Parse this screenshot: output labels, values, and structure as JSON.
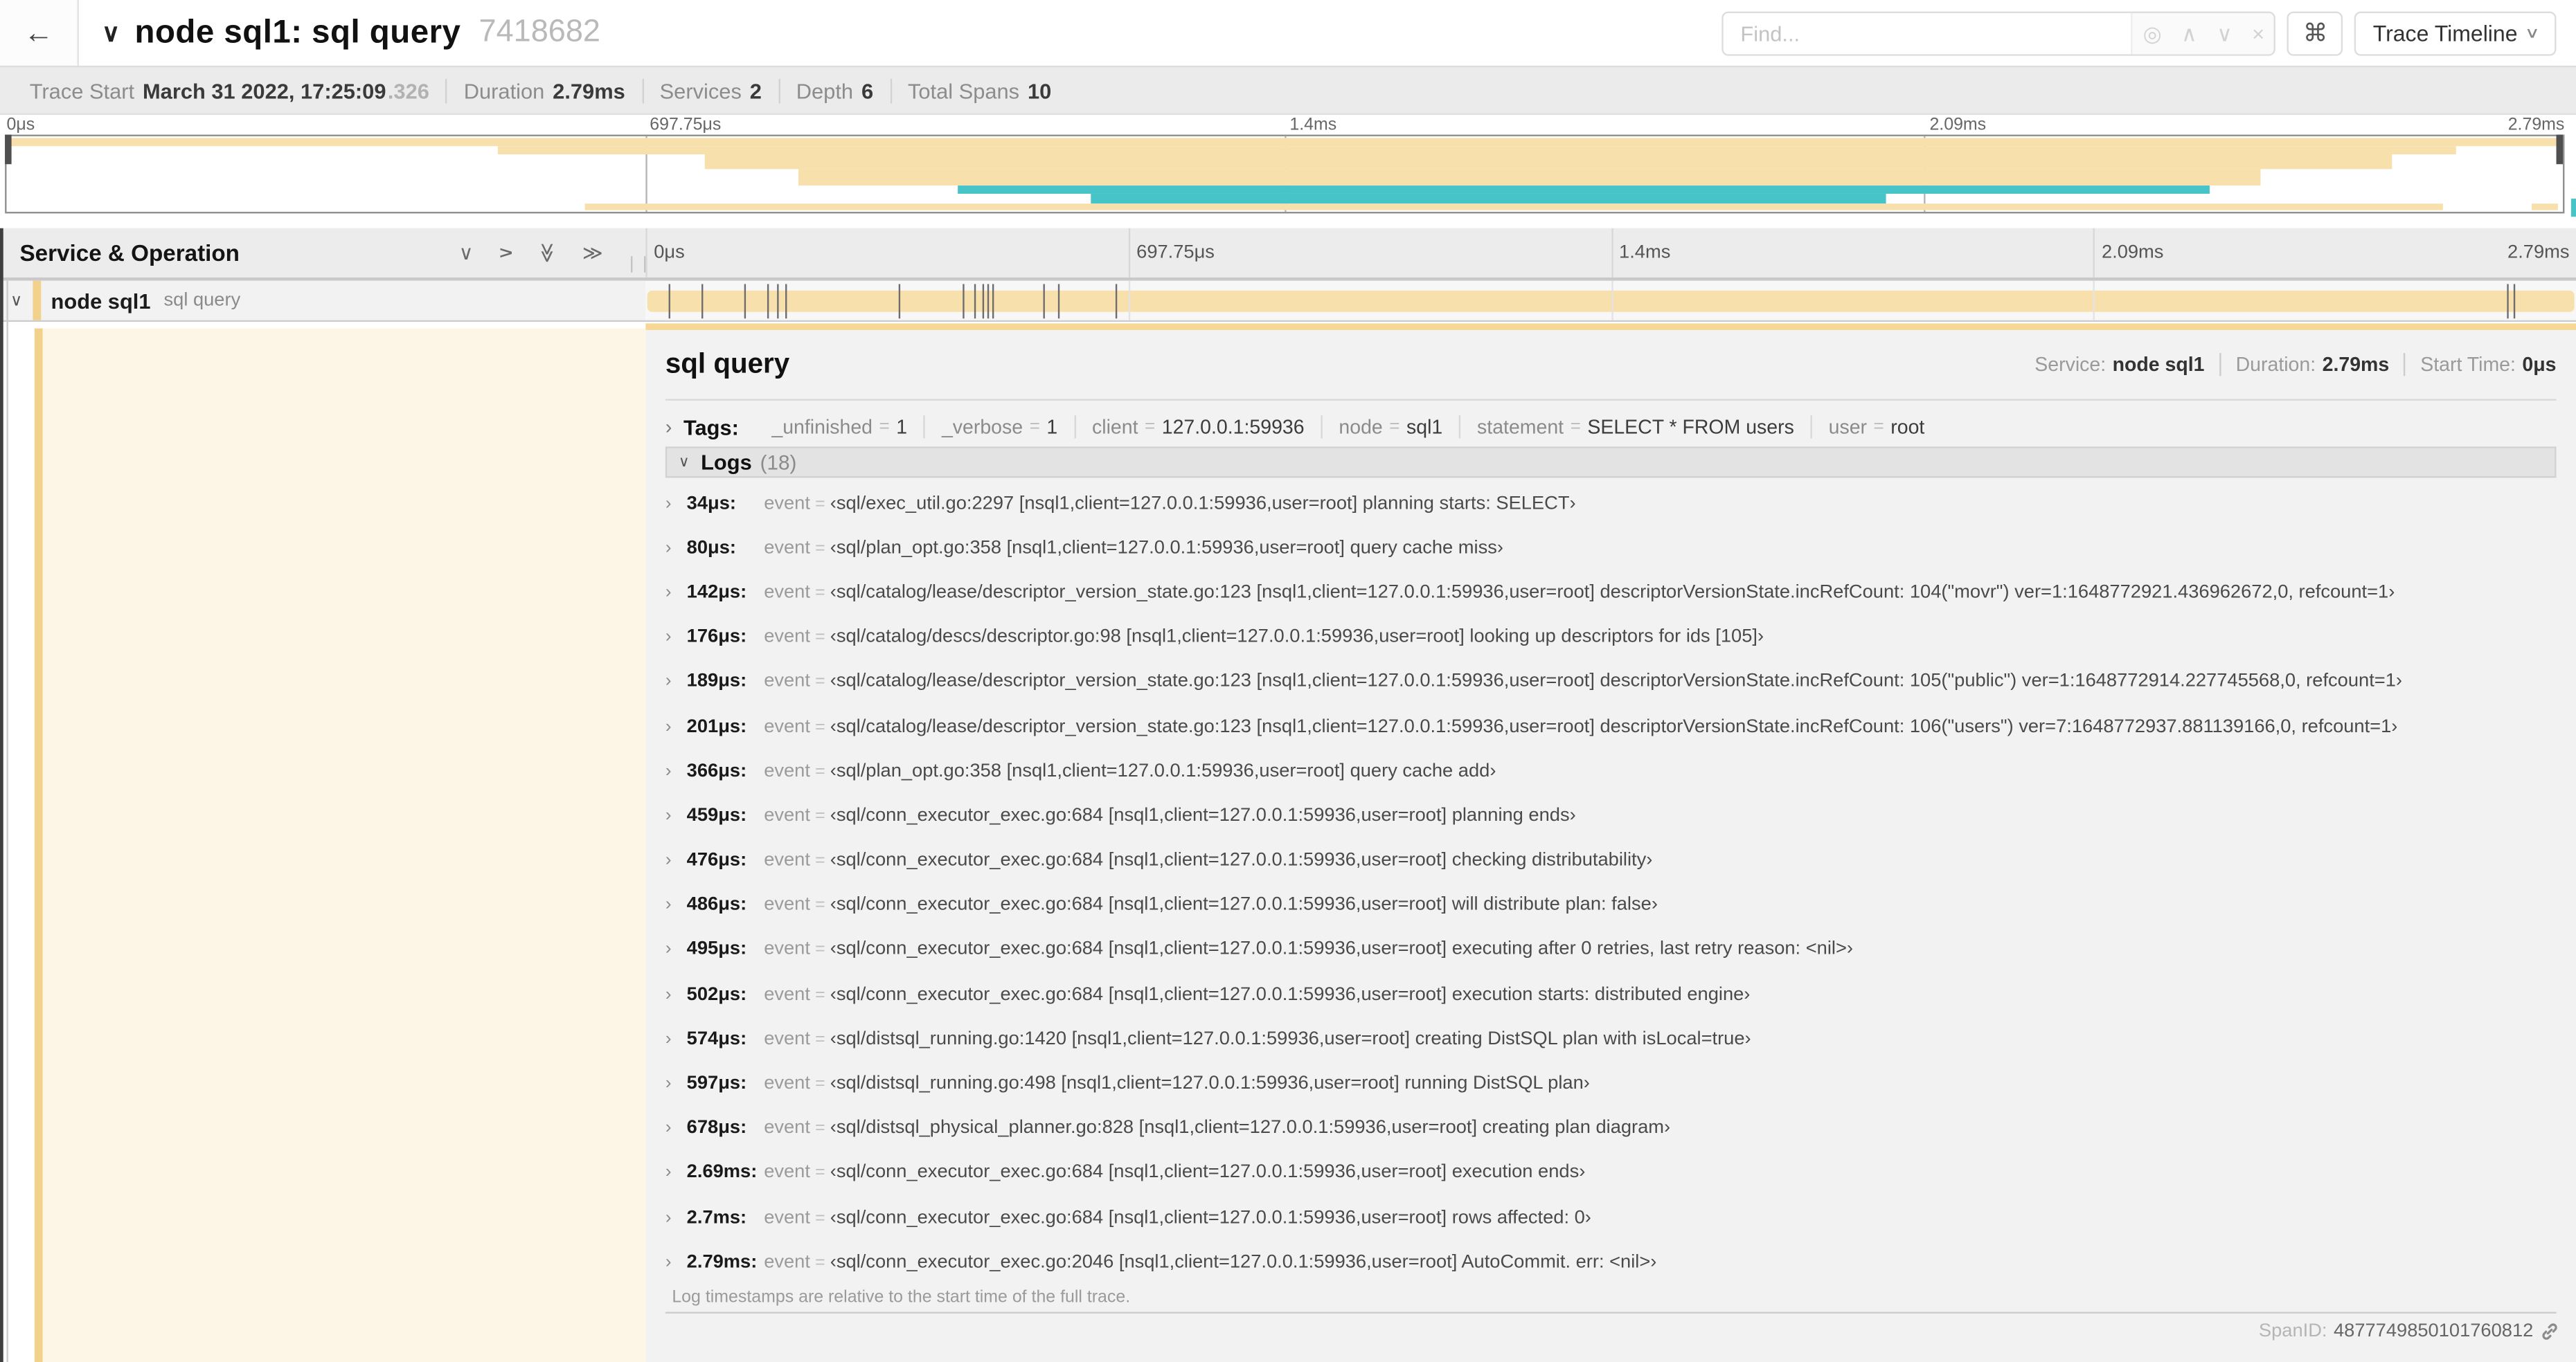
{
  "colors": {
    "span_tan": "#f8e0ac",
    "span_teal": "#47c4c8",
    "accent_stripe": "#f2d18b",
    "accent_top": "#f6d795",
    "cream": "#fdf6e6"
  },
  "header": {
    "back_icon": "←",
    "collapse_icon": "∨",
    "title": "node sql1: sql query",
    "trace_id_short": "7418682",
    "find": {
      "placeholder": "Find...",
      "locate_icon": "◎",
      "prev_icon": "∧",
      "next_icon": "∨",
      "clear_icon": "×"
    },
    "shortcut_button": "⌘",
    "view_dropdown": {
      "label": "Trace Timeline",
      "chevron": "∨"
    }
  },
  "stats": [
    {
      "label": "Trace Start",
      "value": "March 31 2022, 17:25:09",
      "muted": ".326"
    },
    {
      "label": "Duration",
      "value": "2.79ms",
      "muted": ""
    },
    {
      "label": "Services",
      "value": "2",
      "muted": ""
    },
    {
      "label": "Depth",
      "value": "6",
      "muted": ""
    },
    {
      "label": "Total Spans",
      "value": "10",
      "muted": ""
    }
  ],
  "minimap": {
    "labels": [
      {
        "text": "0μs",
        "pos": 0
      },
      {
        "text": "697.75μs",
        "pos": 25
      },
      {
        "text": "1.4ms",
        "pos": 50
      },
      {
        "text": "2.09ms",
        "pos": 75
      },
      {
        "text": "2.79ms",
        "pos": 100
      }
    ],
    "gridlines": [
      25,
      50,
      75
    ],
    "bars": [
      {
        "color": "tan",
        "x": 0,
        "w": 100,
        "y": 2,
        "h": 10
      },
      {
        "color": "tan",
        "x": 19.2,
        "w": 76.6,
        "y": 12,
        "h": 11
      },
      {
        "color": "tan",
        "x": 27.3,
        "w": 66.0,
        "y": 23,
        "h": 21
      },
      {
        "color": "tan",
        "x": 31.0,
        "w": 57.2,
        "y": 44,
        "h": 21
      },
      {
        "color": "teal",
        "x": 37.2,
        "w": 49.0,
        "y": 65,
        "h": 12
      },
      {
        "color": "teal",
        "x": 42.4,
        "w": 31.1,
        "y": 77,
        "h": 12
      },
      {
        "color": "tan",
        "x": 22.6,
        "w": 72.7,
        "y": 89,
        "h": 9
      },
      {
        "color": "tan",
        "x": 98.8,
        "w": 1.0,
        "y": 89,
        "h": 9
      }
    ]
  },
  "grid_header": {
    "title": "Service & Operation",
    "icons": [
      "collapse-one",
      "expand-one",
      "collapse-all",
      "expand-all"
    ],
    "columns": [
      {
        "text": "0μs",
        "pos": 0
      },
      {
        "text": "697.75μs",
        "pos": 25
      },
      {
        "text": "1.4ms",
        "pos": 50
      },
      {
        "text": "2.09ms",
        "pos": 75
      },
      {
        "text": "2.79ms",
        "pos": 100
      }
    ]
  },
  "span_row": {
    "chevron": "∨",
    "service": "node sql1",
    "operation": "sql query",
    "tick_positions_pct": [
      1.22,
      2.87,
      5.09,
      6.31,
      6.77,
      7.2,
      13.12,
      16.45,
      17.06,
      17.42,
      17.74,
      17.99,
      20.57,
      21.4,
      24.3,
      96.42,
      96.77
    ]
  },
  "detail": {
    "title": "sql query",
    "overview": [
      {
        "label": "Service:",
        "value": "node sql1"
      },
      {
        "label": "Duration:",
        "value": "2.79ms"
      },
      {
        "label": "Start Time:",
        "value": "0μs"
      }
    ],
    "tags": {
      "chevron": "›",
      "label": "Tags:",
      "items": [
        {
          "key": "_unfinished",
          "value": "1"
        },
        {
          "key": "_verbose",
          "value": "1"
        },
        {
          "key": "client",
          "value": "127.0.0.1:59936"
        },
        {
          "key": "node",
          "value": "sql1"
        },
        {
          "key": "statement",
          "value": "SELECT * FROM users"
        },
        {
          "key": "user",
          "value": "root"
        }
      ]
    },
    "logs": {
      "chevron": "∨",
      "label": "Logs",
      "count": "(18)",
      "entries": [
        {
          "ts": "34μs:",
          "key": "event",
          "value": "‹sql/exec_util.go:2297 [nsql1,client=127.0.0.1:59936,user=root] planning starts: SELECT›"
        },
        {
          "ts": "80μs:",
          "key": "event",
          "value": "‹sql/plan_opt.go:358 [nsql1,client=127.0.0.1:59936,user=root] query cache miss›"
        },
        {
          "ts": "142μs:",
          "key": "event",
          "value": "‹sql/catalog/lease/descriptor_version_state.go:123 [nsql1,client=127.0.0.1:59936,user=root] descriptorVersionState.incRefCount: 104(\"movr\") ver=1:1648772921.436962672,0, refcount=1›"
        },
        {
          "ts": "176μs:",
          "key": "event",
          "value": "‹sql/catalog/descs/descriptor.go:98 [nsql1,client=127.0.0.1:59936,user=root] looking up descriptors for ids [105]›"
        },
        {
          "ts": "189μs:",
          "key": "event",
          "value": "‹sql/catalog/lease/descriptor_version_state.go:123 [nsql1,client=127.0.0.1:59936,user=root] descriptorVersionState.incRefCount: 105(\"public\") ver=1:1648772914.227745568,0, refcount=1›"
        },
        {
          "ts": "201μs:",
          "key": "event",
          "value": "‹sql/catalog/lease/descriptor_version_state.go:123 [nsql1,client=127.0.0.1:59936,user=root] descriptorVersionState.incRefCount: 106(\"users\") ver=7:1648772937.881139166,0, refcount=1›"
        },
        {
          "ts": "366μs:",
          "key": "event",
          "value": "‹sql/plan_opt.go:358 [nsql1,client=127.0.0.1:59936,user=root] query cache add›"
        },
        {
          "ts": "459μs:",
          "key": "event",
          "value": "‹sql/conn_executor_exec.go:684 [nsql1,client=127.0.0.1:59936,user=root] planning ends›"
        },
        {
          "ts": "476μs:",
          "key": "event",
          "value": "‹sql/conn_executor_exec.go:684 [nsql1,client=127.0.0.1:59936,user=root] checking distributability›"
        },
        {
          "ts": "486μs:",
          "key": "event",
          "value": "‹sql/conn_executor_exec.go:684 [nsql1,client=127.0.0.1:59936,user=root] will distribute plan: false›"
        },
        {
          "ts": "495μs:",
          "key": "event",
          "value": "‹sql/conn_executor_exec.go:684 [nsql1,client=127.0.0.1:59936,user=root] executing after 0 retries, last retry reason: <nil>›"
        },
        {
          "ts": "502μs:",
          "key": "event",
          "value": "‹sql/conn_executor_exec.go:684 [nsql1,client=127.0.0.1:59936,user=root] execution starts: distributed engine›"
        },
        {
          "ts": "574μs:",
          "key": "event",
          "value": "‹sql/distsql_running.go:1420 [nsql1,client=127.0.0.1:59936,user=root] creating DistSQL plan with isLocal=true›"
        },
        {
          "ts": "597μs:",
          "key": "event",
          "value": "‹sql/distsql_running.go:498 [nsql1,client=127.0.0.1:59936,user=root] running DistSQL plan›"
        },
        {
          "ts": "678μs:",
          "key": "event",
          "value": "‹sql/distsql_physical_planner.go:828 [nsql1,client=127.0.0.1:59936,user=root] creating plan diagram›"
        },
        {
          "ts": "2.69ms:",
          "key": "event",
          "value": "‹sql/conn_executor_exec.go:684 [nsql1,client=127.0.0.1:59936,user=root] execution ends›"
        },
        {
          "ts": "2.7ms:",
          "key": "event",
          "value": "‹sql/conn_executor_exec.go:684 [nsql1,client=127.0.0.1:59936,user=root] rows affected: 0›"
        },
        {
          "ts": "2.79ms:",
          "key": "event",
          "value": "‹sql/conn_executor_exec.go:2046 [nsql1,client=127.0.0.1:59936,user=root] AutoCommit. err: <nil>›"
        }
      ],
      "footnote": "Log timestamps are relative to the start time of the full trace."
    },
    "spanid": {
      "label": "SpanID:",
      "value": "4877749850101760812"
    }
  }
}
